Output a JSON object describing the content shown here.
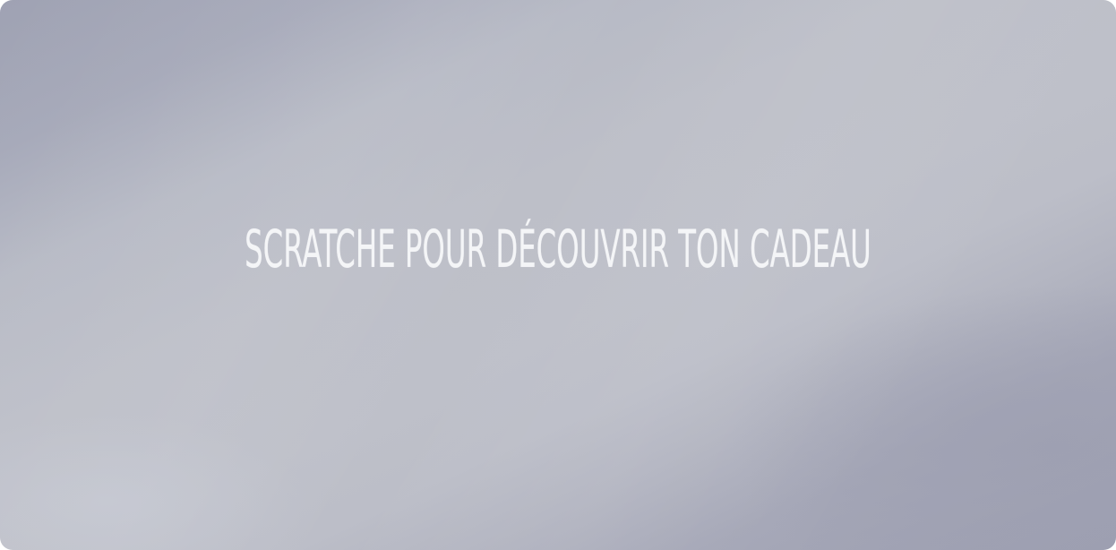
{
  "scratch_card": {
    "prompt": "SCRATCHE POUR DÉCOUVRIR TON CADEAU"
  },
  "colors": {
    "surface_light": "#bec0c9",
    "surface_dark": "#9c9eb0",
    "text": "#f5f6f8"
  }
}
